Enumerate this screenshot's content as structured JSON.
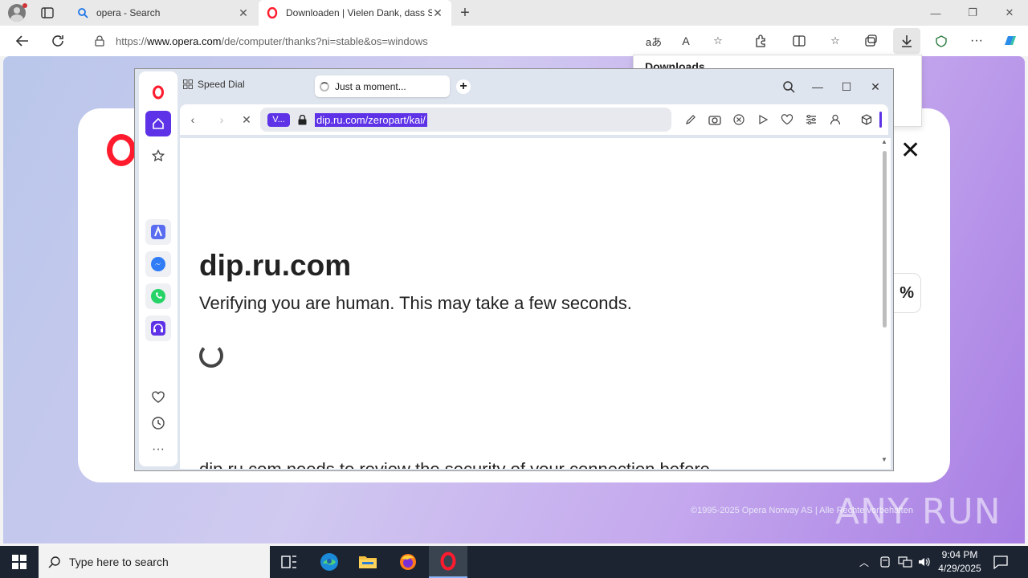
{
  "edge": {
    "tabs": [
      {
        "title": "opera - Search"
      },
      {
        "title": "Downloaden | Vielen Dank, dass Sie"
      }
    ],
    "address": {
      "prefix": "https://",
      "host": "www.opera.com",
      "path": "/de/computer/thanks?ni=stable&os=windows"
    },
    "downloads_title": "Downloads"
  },
  "opera_page": {
    "percent_fragment": "%",
    "copyright": "©1995-2025 Opera Norway AS | Alle Rechte vorbehalten"
  },
  "opera": {
    "speed_dial_label": "Speed Dial",
    "tab_title": "Just a moment...",
    "badge": "V...",
    "url": "dip.ru.com/zeropart/kai/",
    "site_name": "dip.ru.com",
    "verify_text": "Verifying you are human. This may take a few seconds.",
    "cut_text": "dip.ru.com needs to review the security of your connection before"
  },
  "watermark": "ANY RUN",
  "taskbar": {
    "search_placeholder": "Type here to search",
    "time": "9:04 PM",
    "date": "4/29/2025"
  },
  "colors": {
    "opera_red": "#ff1b2d",
    "opera_purple": "#5e32e6",
    "taskbar": "#1c2432"
  }
}
